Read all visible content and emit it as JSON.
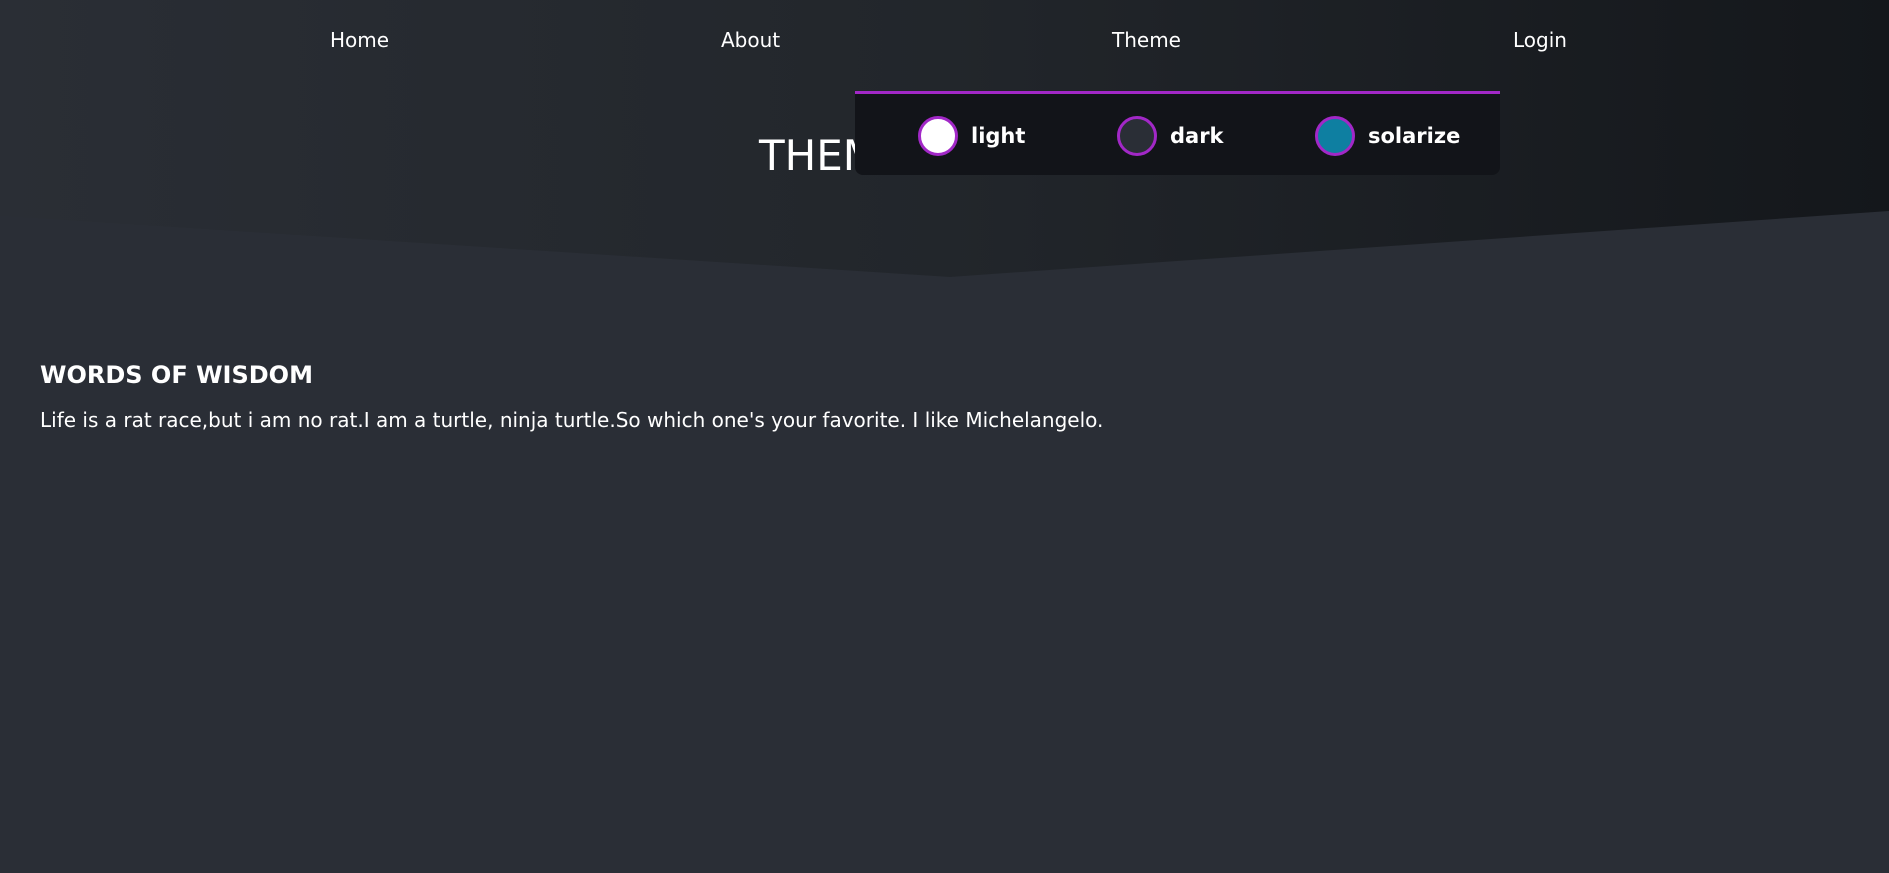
{
  "nav": {
    "home": "Home",
    "about": "About",
    "theme": "Theme",
    "login": "Login"
  },
  "hero": {
    "title": "THEM"
  },
  "theme_menu": {
    "options": [
      {
        "label": "light",
        "color": "#ffffff"
      },
      {
        "label": "dark",
        "color": "#2a2e36"
      },
      {
        "label": "solarize",
        "color": "#0e7fa1"
      }
    ],
    "accent": "#a228c7"
  },
  "content": {
    "title": "WORDS OF WISDOM",
    "text": "Life is a rat race,but i am no rat.I am a turtle, ninja turtle.So which one's your favorite. I like Michelangelo."
  },
  "colors": {
    "background": "#2a2e36",
    "header_dark": "#14171b",
    "dropdown_bg": "#121419"
  }
}
